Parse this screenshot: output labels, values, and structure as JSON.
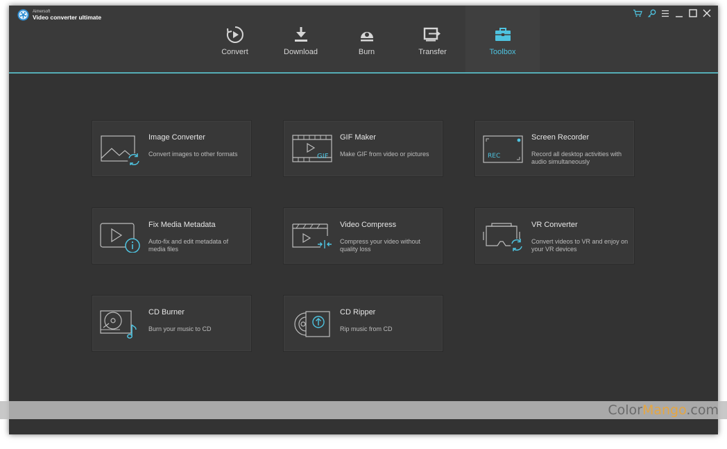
{
  "app": {
    "company": "Aimersoft",
    "product": "Video converter ultimate"
  },
  "nav": {
    "tabs": [
      {
        "label": "Convert",
        "icon": "convert-icon"
      },
      {
        "label": "Download",
        "icon": "download-icon"
      },
      {
        "label": "Burn",
        "icon": "burn-icon"
      },
      {
        "label": "Transfer",
        "icon": "transfer-icon"
      },
      {
        "label": "Toolbox",
        "icon": "toolbox-icon",
        "active": true
      }
    ]
  },
  "colors": {
    "accent": "#4ec3e0",
    "background": "#333333",
    "card": "#383838",
    "separator": "#55aeb7"
  },
  "tools": [
    {
      "title": "Image Converter",
      "desc": "Convert images to other formats",
      "icon": "image-converter-icon"
    },
    {
      "title": "GIF Maker",
      "desc": "Make GIF from video or pictures",
      "icon": "gif-maker-icon",
      "icon_text": "GIF"
    },
    {
      "title": "Screen Recorder",
      "desc": "Record all desktop activities with audio simultaneously",
      "icon": "screen-recorder-icon",
      "icon_text": "REC"
    },
    {
      "title": "Fix Media Metadata",
      "desc": "Auto-fix and edit metadata of media files",
      "icon": "metadata-icon"
    },
    {
      "title": "Video Compress",
      "desc": "Compress your video without quality loss",
      "icon": "video-compress-icon"
    },
    {
      "title": "VR Converter",
      "desc": "Convert videos to VR and enjoy on your VR devices",
      "icon": "vr-converter-icon"
    },
    {
      "title": "CD Burner",
      "desc": "Burn your music to CD",
      "icon": "cd-burner-icon"
    },
    {
      "title": "CD Ripper",
      "desc": "Rip music from CD",
      "icon": "cd-ripper-icon"
    }
  ],
  "watermark": {
    "part1": "Color",
    "part2": "Mango",
    "part3": ".com"
  }
}
